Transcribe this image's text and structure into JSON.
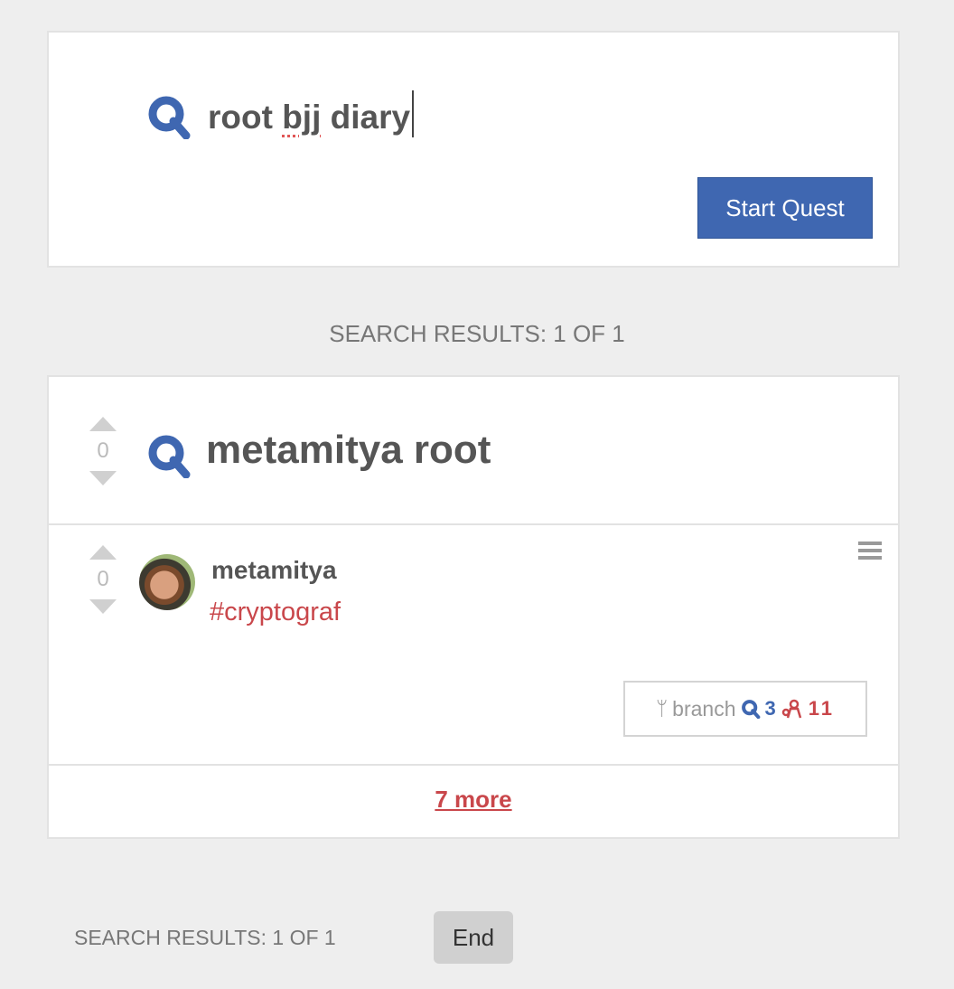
{
  "colors": {
    "brand_blue": "#3f67b1",
    "accent_red": "#c9474b",
    "background": "#eeeeee"
  },
  "search": {
    "query_prefix": "root ",
    "query_misspelled": "bjj",
    "query_suffix": " diary",
    "button_label": "Start Quest",
    "icon": "quest-logo-icon"
  },
  "results_heading": "SEARCH RESULTS: 1 OF 1",
  "result": {
    "vote_count": "0",
    "title": "metamitya root",
    "post": {
      "vote_count": "0",
      "author": "metamitya",
      "tag": "#cryptograf",
      "branch": {
        "label": "branch",
        "quest_count": "3",
        "people_count": "11"
      }
    },
    "more_label": "7 more"
  },
  "footer": {
    "heading": "SEARCH RESULTS: 1 OF 1",
    "end_label": "End"
  }
}
